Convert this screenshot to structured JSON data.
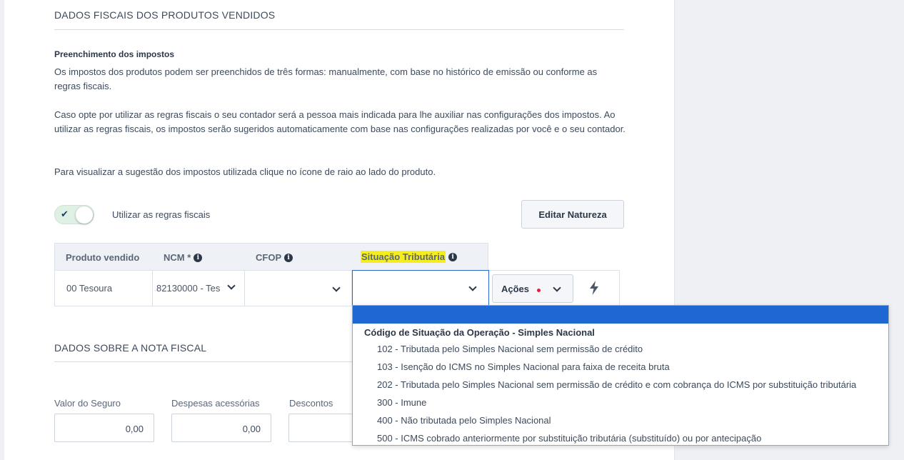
{
  "section1": {
    "title": "DADOS FISCAIS DOS PRODUTOS VENDIDOS",
    "subhead": "Preenchimento dos impostos",
    "para1": "Os impostos dos produtos podem ser preenchidos de três formas: manualmente, com base no histórico de emissão ou conforme as regras fiscais.",
    "para2": "Caso opte por utilizar as regras fiscais o seu contador será a pessoa mais indicada para lhe auxiliar nas configurações dos impostos. Ao utilizar as regras fiscais, os impostos serão sugeridos automaticamente com base nas configurações realizadas por você e o seu contador.",
    "para3": "Para visualizar a sugestão dos impostos utilizada clique no ícone de raio ao lado do produto.",
    "toggle_label": "Utilizar as regras fiscais",
    "toggle_on": true,
    "edit_button": "Editar Natureza"
  },
  "table": {
    "headers": {
      "produto": "Produto vendido",
      "ncm": "NCM *",
      "cfop": "CFOP",
      "situacao": "Situação Tributária"
    },
    "row": {
      "produto": "00 Tesoura",
      "ncm": "82130000 - Tes",
      "cfop": "",
      "situacao": ""
    },
    "acoes_button": "Ações"
  },
  "section2": {
    "title": "DADOS SOBRE A NOTA FISCAL",
    "fields": [
      {
        "label": "Valor do Seguro",
        "value": "0,00"
      },
      {
        "label": "Despesas acessórias",
        "value": "0,00"
      },
      {
        "label": "Descontos",
        "value": ""
      }
    ]
  },
  "dropdown": {
    "group": "Código de Situação da Operação - Simples Nacional",
    "options": [
      "102 - Tributada pelo Simples Nacional sem permissão de crédito",
      "103 - Isenção do ICMS no Simples Nacional para faixa de receita bruta",
      "202 - Tributada pelo Simples Nacional sem permissão de crédito e com cobrança do ICMS por substituição tributária",
      "300 - Imune",
      "400 - Não tributada pelo Simples Nacional",
      "500 - ICMS cobrado anteriormente por substituição tributária (substituído) ou por antecipação"
    ]
  },
  "colors": {
    "highlight": "#f5ee1e",
    "dropdown_selected": "#1f68d3",
    "toggle_on": "#dff0e4"
  }
}
